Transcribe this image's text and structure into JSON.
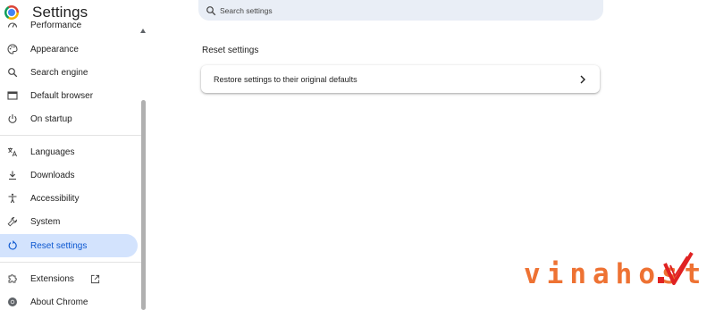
{
  "sidebar": {
    "title": "Settings",
    "items": [
      {
        "label": "Performance",
        "icon": "speedometer-icon"
      },
      {
        "label": "Appearance",
        "icon": "palette-icon"
      },
      {
        "label": "Search engine",
        "icon": "search-icon"
      },
      {
        "label": "Default browser",
        "icon": "browser-window-icon"
      },
      {
        "label": "On startup",
        "icon": "power-icon"
      },
      {
        "label": "Languages",
        "icon": "translate-icon"
      },
      {
        "label": "Downloads",
        "icon": "download-icon"
      },
      {
        "label": "Accessibility",
        "icon": "accessibility-icon"
      },
      {
        "label": "System",
        "icon": "wrench-icon"
      },
      {
        "label": "Reset settings",
        "icon": "reset-icon",
        "active": true
      },
      {
        "label": "Extensions",
        "icon": "puzzle-icon"
      },
      {
        "label": "About Chrome",
        "icon": "chrome-icon"
      }
    ]
  },
  "search": {
    "placeholder": "Search settings"
  },
  "main": {
    "section_title": "Reset settings",
    "card": {
      "label": "Restore settings to their original defaults"
    }
  },
  "watermark": {
    "text": "vinahost"
  },
  "colors": {
    "accent": "#0b57d0",
    "active_bg": "#d3e3fd",
    "search_bg": "#e9eef6",
    "watermark": "#ee7233"
  }
}
